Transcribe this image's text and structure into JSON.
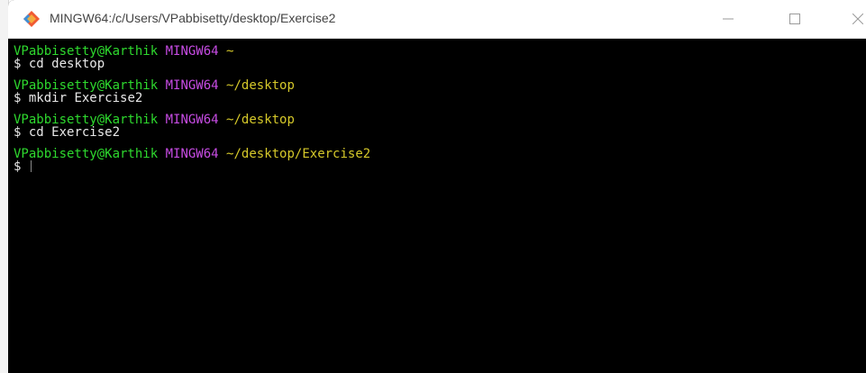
{
  "window": {
    "title": "MINGW64:/c/Users/VPabbisetty/desktop/Exercise2",
    "icon": "git-bash-diamond-icon",
    "controls": {
      "minimize": "minimize-icon",
      "maximize": "maximize-icon",
      "close": "close-icon"
    }
  },
  "terminal": {
    "colors": {
      "background": "#000000",
      "user": "#2ed92e",
      "system": "#c74ce4",
      "path": "#d6c92a",
      "text": "#e8e8e8"
    },
    "blocks": [
      {
        "user": "VPabbisetty@Karthik",
        "system": "MINGW64",
        "path": "~",
        "prompt": "$",
        "command": "cd desktop"
      },
      {
        "user": "VPabbisetty@Karthik",
        "system": "MINGW64",
        "path": "~/desktop",
        "prompt": "$",
        "command": "mkdir Exercise2"
      },
      {
        "user": "VPabbisetty@Karthik",
        "system": "MINGW64",
        "path": "~/desktop",
        "prompt": "$",
        "command": "cd Exercise2"
      },
      {
        "user": "VPabbisetty@Karthik",
        "system": "MINGW64",
        "path": "~/desktop/Exercise2",
        "prompt": "$",
        "command": ""
      }
    ]
  }
}
